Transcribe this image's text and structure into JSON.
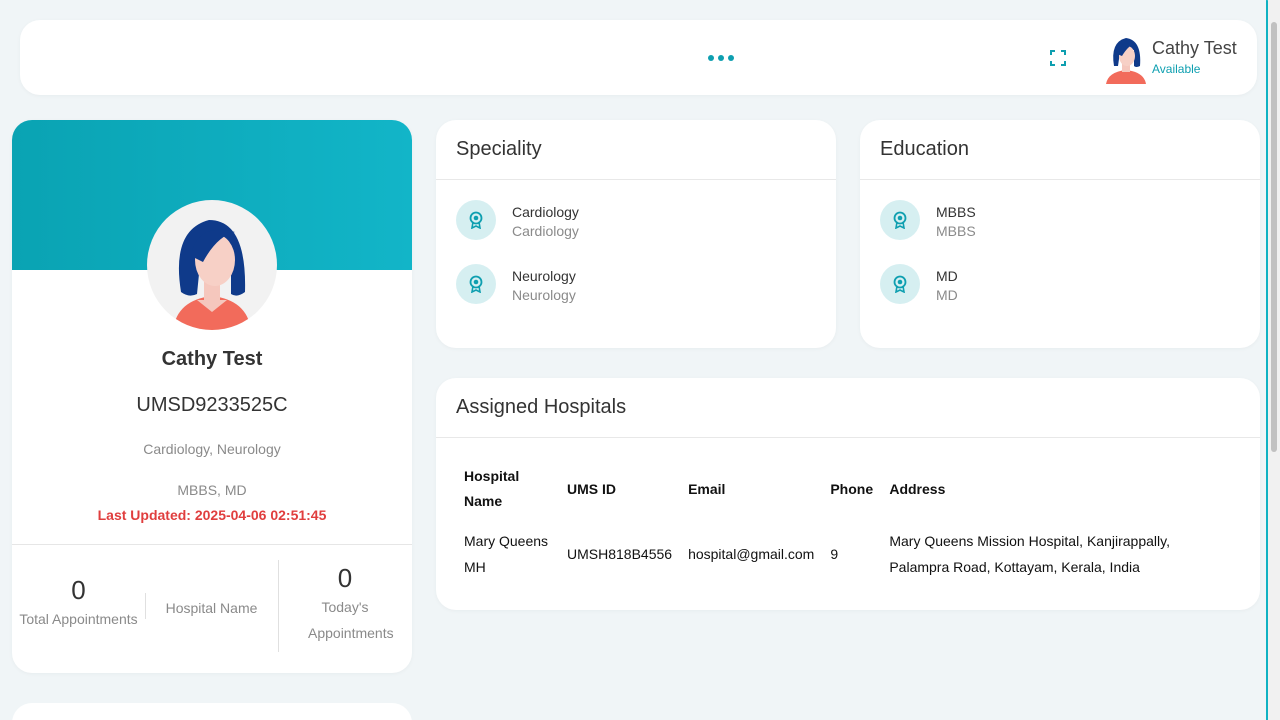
{
  "topbar": {
    "user_name": "Cathy Test",
    "user_status": "Available"
  },
  "profile": {
    "name": "Cathy Test",
    "ums_id": "UMSD9233525C",
    "specialities": "Cardiology, Neurology",
    "education": "MBBS, MD",
    "last_updated": "Last Updated: 2025-04-06 02:51:45",
    "stats": {
      "total_appointments_value": "0",
      "total_appointments_label": "Total Appointments",
      "hospital_name_label": "Hospital Name",
      "todays_appointments_value": "0",
      "todays_appointments_label": "Today's Appointments"
    }
  },
  "speciality": {
    "title": "Speciality",
    "items": [
      {
        "title": "Cardiology",
        "subtitle": "Cardiology"
      },
      {
        "title": "Neurology",
        "subtitle": "Neurology"
      }
    ]
  },
  "education": {
    "title": "Education",
    "items": [
      {
        "title": "MBBS",
        "subtitle": "MBBS"
      },
      {
        "title": "MD",
        "subtitle": "MD"
      }
    ]
  },
  "hospitals": {
    "title": "Assigned Hospitals",
    "columns": [
      "Hospital Name",
      "UMS ID",
      "Email",
      "Phone",
      "Address"
    ],
    "rows": [
      {
        "hospital_name": "Mary Queens MH",
        "ums_id": "UMSH818B4556",
        "email": "hospital@gmail.com",
        "phone": "9",
        "address": "Mary Queens Mission Hospital, Kanjirappally, Palampra Road, Kottayam, Kerala, India"
      }
    ]
  },
  "colors": {
    "accent": "#0e9fb0",
    "banner": "#10b0c2",
    "alert": "#e03e3e",
    "icon_bg": "#d6eff1",
    "background": "#f0f5f7"
  },
  "icons": {
    "more": "more-dots-icon",
    "fullscreen": "fullscreen-icon",
    "item": "award-ribbon-icon"
  }
}
